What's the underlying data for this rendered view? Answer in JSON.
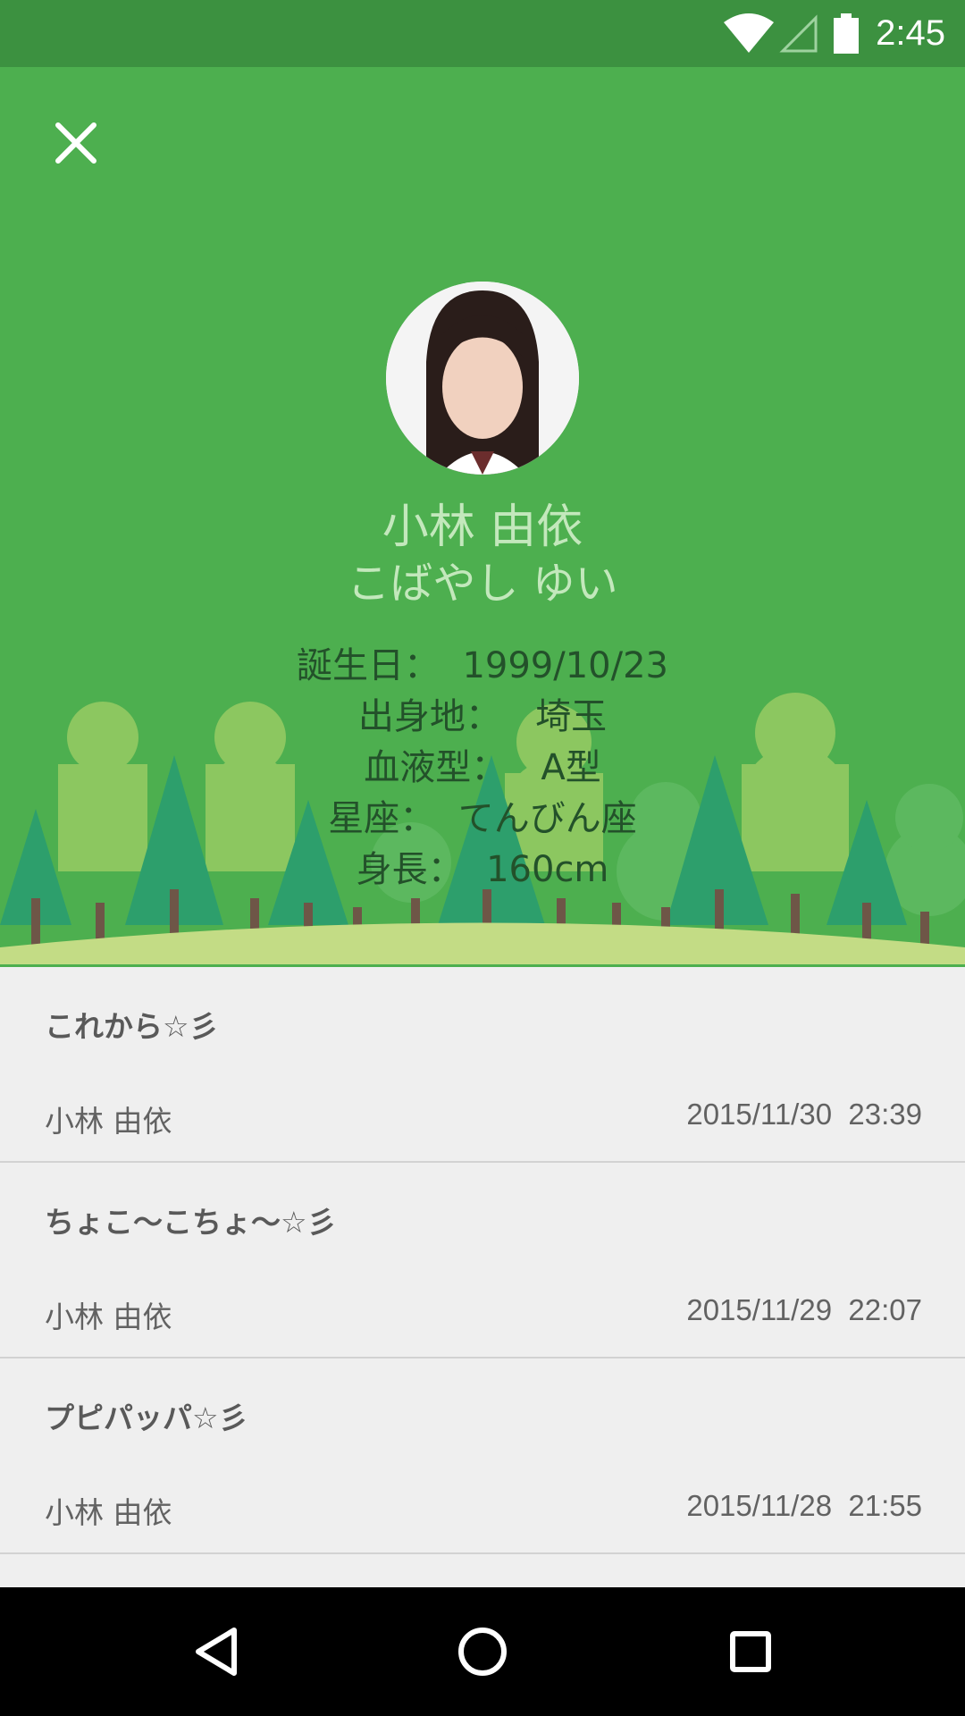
{
  "status_bar": {
    "time": "2:45",
    "icons": [
      "wifi-icon",
      "signal-icon",
      "battery-icon"
    ]
  },
  "header": {
    "close_icon": "close-icon",
    "name": "小林 由依",
    "kana": "こばやし ゆい",
    "info": [
      {
        "label": "誕生日：",
        "value": "1999/10/23"
      },
      {
        "label": "出身地：",
        "value": "埼玉"
      },
      {
        "label": "血液型：",
        "value": "A型"
      },
      {
        "label": "星座：",
        "value": "てんびん座"
      },
      {
        "label": "身長：",
        "value": "160cm"
      }
    ],
    "colors": {
      "background": "#4daf4f",
      "name_text": "#c3e8bc",
      "info_text": "#23512a"
    }
  },
  "posts": [
    {
      "title": "これから☆彡",
      "author": "小林 由依",
      "date": "2015/11/30",
      "time": "23:39"
    },
    {
      "title": "ちょこ〜こちょ〜☆彡",
      "author": "小林 由依",
      "date": "2015/11/29",
      "time": "22:07"
    },
    {
      "title": "プピパッパ☆彡",
      "author": "小林 由依",
      "date": "2015/11/28",
      "time": "21:55"
    }
  ],
  "nav_bar": {
    "icons": [
      "back-icon",
      "home-icon",
      "recents-icon"
    ]
  }
}
